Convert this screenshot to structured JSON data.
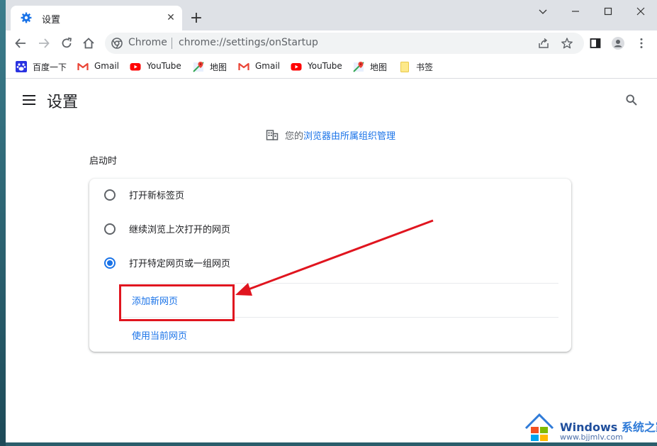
{
  "tab": {
    "title": "设置",
    "close_symbol": "✕"
  },
  "new_tab_symbol": "+",
  "address_bar": {
    "chip": "Chrome",
    "url": "chrome://settings/onStartup"
  },
  "bookmarks": [
    {
      "label": "百度一下",
      "icon": "baidu-icon"
    },
    {
      "label": "Gmail",
      "icon": "gmail-icon"
    },
    {
      "label": "YouTube",
      "icon": "youtube-icon"
    },
    {
      "label": "地图",
      "icon": "maps-icon"
    },
    {
      "label": "Gmail",
      "icon": "gmail-icon"
    },
    {
      "label": "YouTube",
      "icon": "youtube-icon"
    },
    {
      "label": "地图",
      "icon": "maps-icon"
    },
    {
      "label": "书签",
      "icon": "folder-icon"
    }
  ],
  "settings": {
    "title": "设置",
    "managed": {
      "prefix": "您的",
      "link": "浏览器由所属组织管理"
    },
    "section_label": "启动时",
    "options": [
      {
        "label": "打开新标签页",
        "checked": false
      },
      {
        "label": "继续浏览上次打开的网页",
        "checked": false
      },
      {
        "label": "打开特定网页或一组网页",
        "checked": true
      }
    ],
    "add_page": "添加新网页",
    "use_current": "使用当前网页"
  },
  "colors": {
    "accent": "#1a73e8",
    "annotation": "#e0151f"
  },
  "watermark": {
    "title": "Windows",
    "brand": "系统之家",
    "url": "www.bjjmlv.com"
  }
}
